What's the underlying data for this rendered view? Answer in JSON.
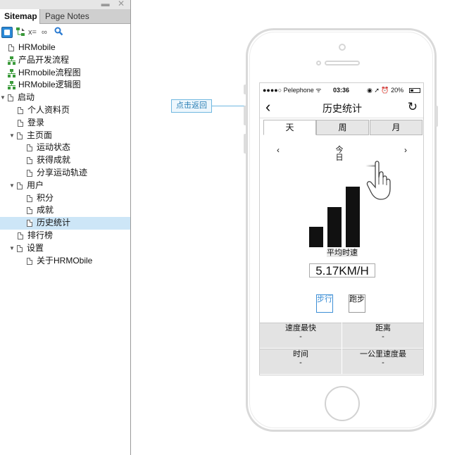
{
  "panel": {
    "window_controls": "▬ ✕",
    "tabs": [
      "Sitemap",
      "Page Notes"
    ],
    "toolbar": {
      "var_label": "x=",
      "link_label": "∞",
      "search_label": "🔍"
    },
    "tree": [
      {
        "label": "HRMobile",
        "type": "page",
        "depth": 0
      },
      {
        "label": "产品开发流程",
        "type": "flow",
        "depth": 0
      },
      {
        "label": "HRmobile流程图",
        "type": "flow",
        "depth": 0
      },
      {
        "label": "HRMobile逻辑图",
        "type": "flow",
        "depth": 0
      },
      {
        "label": "启动",
        "type": "page",
        "depth": 0,
        "expanded": true
      },
      {
        "label": "个人资料页",
        "type": "page",
        "depth": 1
      },
      {
        "label": "登录",
        "type": "page",
        "depth": 1
      },
      {
        "label": "主页面",
        "type": "page",
        "depth": 1,
        "expanded": true
      },
      {
        "label": "运动状态",
        "type": "page",
        "depth": 2
      },
      {
        "label": "获得成就",
        "type": "page",
        "depth": 2
      },
      {
        "label": "分享运动轨迹",
        "type": "page",
        "depth": 2
      },
      {
        "label": "用户",
        "type": "page",
        "depth": 1,
        "expanded": true
      },
      {
        "label": "积分",
        "type": "page",
        "depth": 2
      },
      {
        "label": "成就",
        "type": "page",
        "depth": 2
      },
      {
        "label": "历史统计",
        "type": "page",
        "depth": 2,
        "selected": true
      },
      {
        "label": "排行榜",
        "type": "page",
        "depth": 1
      },
      {
        "label": "设置",
        "type": "page",
        "depth": 1,
        "expanded": true
      },
      {
        "label": "关于HRMObile",
        "type": "page",
        "depth": 2
      }
    ]
  },
  "callout": {
    "label": "点击返回"
  },
  "phone": {
    "status": {
      "carrier": "●●●●○ Pelephone ᯤ",
      "time": "03:36",
      "right": "◉ ➚ ⏰ 20%"
    },
    "nav": {
      "back": "‹",
      "title": "历史统计",
      "refresh": "↻"
    },
    "segments": [
      "天",
      "周",
      "月"
    ],
    "active_segment": 0,
    "date": {
      "prev": "‹",
      "next": "›",
      "label": "今日"
    },
    "chart_bars": [
      0.3,
      0.6,
      0.9
    ],
    "avg": {
      "label": "平均时速",
      "value": "5.17KM/H"
    },
    "modes": {
      "walk": "步行",
      "run": "跑步"
    },
    "stats": [
      {
        "key": "速度最快",
        "value": "-"
      },
      {
        "key": "距离",
        "value": "-"
      },
      {
        "key": "时间",
        "value": "-"
      },
      {
        "key": "一公里速度最",
        "value": "-"
      }
    ]
  },
  "colors": {
    "selected_row": "#cde6f7",
    "accent": "#3d8fd6",
    "callout_border": "#6fb7e0"
  }
}
